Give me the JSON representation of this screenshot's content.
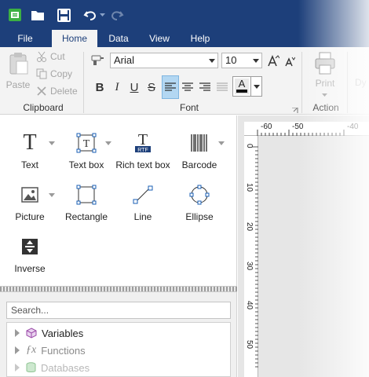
{
  "quick_access": {
    "icons": [
      "app-logo-icon",
      "open-folder-icon",
      "save-icon",
      "undo-icon",
      "redo-icon"
    ]
  },
  "menu": {
    "tabs": [
      "File",
      "Home",
      "Data",
      "View",
      "Help"
    ],
    "active": "Home"
  },
  "ribbon": {
    "clipboard": {
      "paste": "Paste",
      "cut": "Cut",
      "copy": "Copy",
      "delete": "Delete",
      "group_label": "Clipboard"
    },
    "font": {
      "font_name": "Arial",
      "font_size": "10",
      "group_label": "Font",
      "buttons": [
        "B",
        "I",
        "U",
        "S"
      ],
      "color_letter": "A"
    },
    "action": {
      "print": "Print",
      "group_label": "Action",
      "cutoff": "Dy"
    }
  },
  "toolbox": {
    "tools": [
      "Text",
      "Text box",
      "Rich text box",
      "Barcode",
      "Picture",
      "Rectangle",
      "Line",
      "Ellipse",
      "Inverse"
    ],
    "rtf_badge": "RTF"
  },
  "explorer": {
    "search_placeholder": "Search...",
    "items": [
      "Variables",
      "Functions",
      "Databases"
    ]
  },
  "ruler": {
    "h_labels": [
      "-60",
      "-50",
      "-40"
    ],
    "v_labels": [
      "0",
      "10",
      "20",
      "30",
      "40",
      "50"
    ]
  },
  "colors": {
    "title_bar": "#1d3f7a",
    "ribbon": "#f3f3f3",
    "accent": "#b3d7f2"
  }
}
